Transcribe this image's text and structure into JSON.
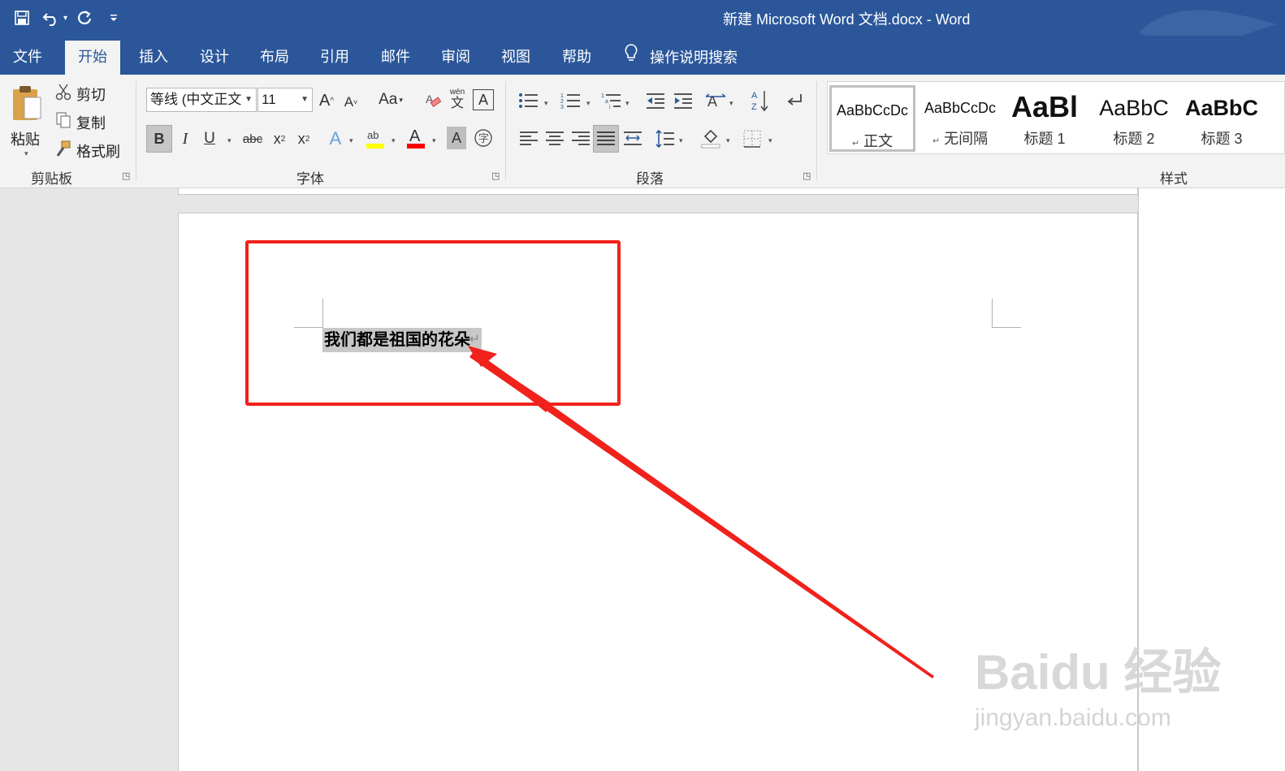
{
  "window": {
    "title": "新建 Microsoft Word 文档.docx  -  Word"
  },
  "quick_access": {
    "save_icon": "save-icon",
    "undo_icon": "undo-icon",
    "redo_icon": "repeat-icon",
    "customize_icon": "customize-dropdown-icon"
  },
  "tabs": [
    {
      "label": "文件"
    },
    {
      "label": "开始"
    },
    {
      "label": "插入"
    },
    {
      "label": "设计"
    },
    {
      "label": "布局"
    },
    {
      "label": "引用"
    },
    {
      "label": "邮件"
    },
    {
      "label": "审阅"
    },
    {
      "label": "视图"
    },
    {
      "label": "帮助"
    }
  ],
  "tell_me": {
    "label": "操作说明搜索"
  },
  "clipboard": {
    "paste_label": "粘贴",
    "cut_label": "剪切",
    "copy_label": "复制",
    "format_painter_label": "格式刷",
    "group_label": "剪贴板"
  },
  "font": {
    "font_name": "等线 (中文正文",
    "font_size": "11",
    "change_case": "Aa",
    "phonetic": "wén",
    "phonetic_char": "文",
    "group_label": "字体"
  },
  "paragraph": {
    "group_label": "段落"
  },
  "styles": {
    "group_label": "样式",
    "items": [
      {
        "sample": "AaBbCcDc",
        "name": "正文",
        "mark": "↵"
      },
      {
        "sample": "AaBbCcDc",
        "name": "无间隔",
        "mark": "↵"
      },
      {
        "sample": "AaBl",
        "name": "标题 1"
      },
      {
        "sample": "AaBbC",
        "name": "标题 2"
      },
      {
        "sample": "AaBbC",
        "name": "标题 3"
      }
    ]
  },
  "document": {
    "text": "我们都是祖国的花朵",
    "paragraph_mark": "↵"
  },
  "watermark": {
    "brand": "Baidu 经验",
    "url": "jingyan.baidu.com"
  },
  "colors": {
    "title_bar": "#2b579a",
    "annotation_red": "#f0221b",
    "highlight_yellow": "#ffff00",
    "font_color_red": "#ff0000"
  }
}
